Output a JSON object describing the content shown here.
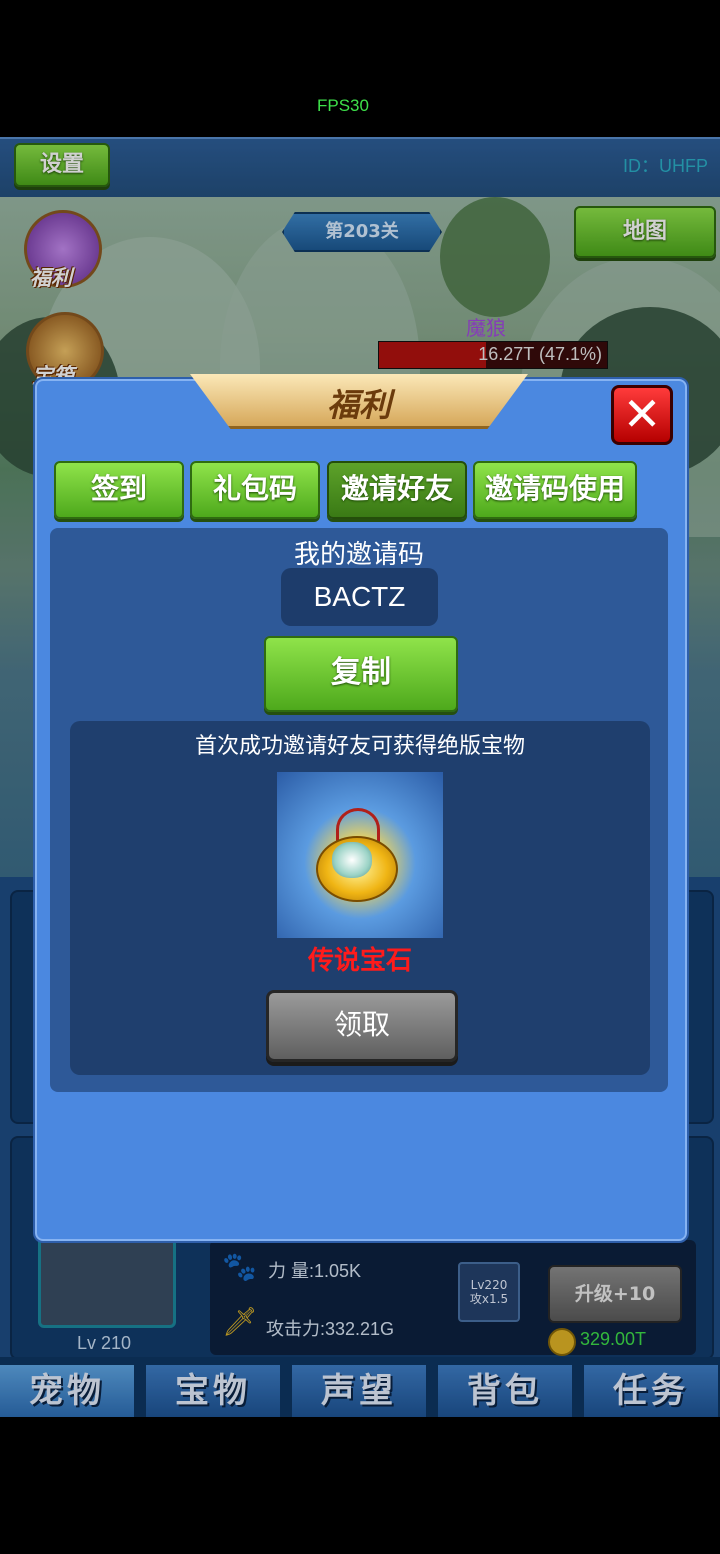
{
  "status": {
    "fps": "FPS30"
  },
  "header": {
    "settings_label": "设置",
    "player_id": "ID：UHFP"
  },
  "scene": {
    "stage": "第203关",
    "map_label": "地图",
    "side_buttons": [
      {
        "label": "福利"
      },
      {
        "label": "宝箱"
      }
    ],
    "enemy": {
      "name": "魔狼",
      "hp_text": "16.27T (47.1%)",
      "hp_percent": 47.1
    }
  },
  "dialog": {
    "title": "福利",
    "tabs": [
      {
        "label": "签到"
      },
      {
        "label": "礼包码"
      },
      {
        "label": "邀请好友"
      },
      {
        "label": "邀请码使用"
      }
    ],
    "invite": {
      "my_code_label": "我的邀请码",
      "code": "BACTZ",
      "copy_label": "复制",
      "reward_desc": "首次成功邀请好友可获得绝版宝物",
      "reward_name": "传说宝石",
      "reward_icon": "legendary-gem-icon",
      "claim_label": "领取"
    }
  },
  "pet": {
    "level": "Lv 210",
    "power": "力  量:1.05K",
    "attack": "攻击力:332.21G",
    "skill": {
      "line1": "Lv220",
      "line2": "攻x1.5"
    },
    "upgrade_label": "升级+10",
    "cost": "329.00T"
  },
  "bottom_tabs": [
    {
      "label": "宠物"
    },
    {
      "label": "宝物"
    },
    {
      "label": "声望"
    },
    {
      "label": "背包"
    },
    {
      "label": "任务"
    }
  ],
  "colors": {
    "accent_green": "#5bc221",
    "dialog_blue": "#4b88e0",
    "reward_red": "#ff1b1b",
    "cost_green": "#3fe04a"
  }
}
